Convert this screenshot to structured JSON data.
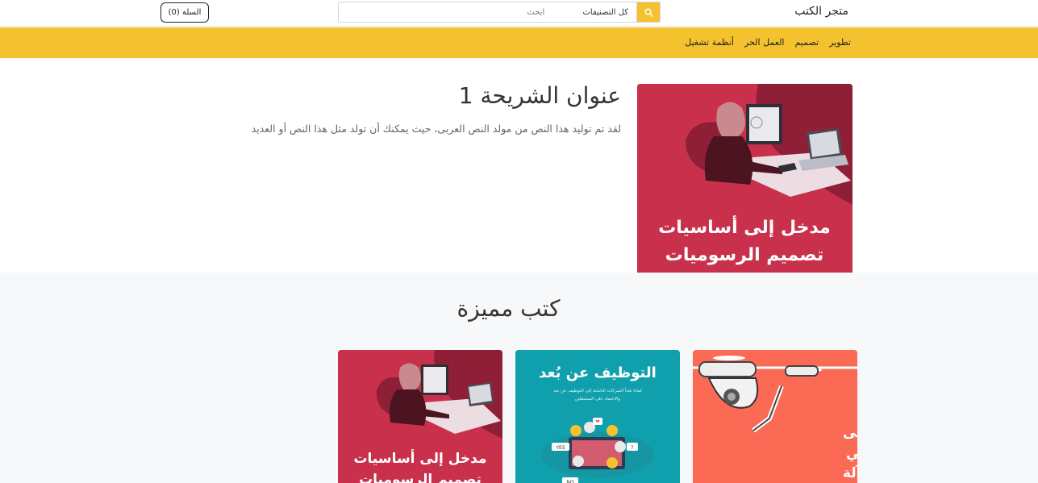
{
  "header": {
    "brand": "متجر الكتب",
    "search_placeholder": "ابحث",
    "category_select": "كل التصنيفات",
    "cart_label": "السلة (0)"
  },
  "categories": [
    "تطوير",
    "تصميم",
    "العمل الحر",
    "أنظمة تشغيل"
  ],
  "hero": {
    "title": "عنوان الشريحة 1",
    "text": "لقد تم توليد هذا النص من مولد النص العربى، حيث يمكنك أن تولد مثل هذا النص أو العديد",
    "cover_line1": "مدخل إلى أساسيات",
    "cover_line2": "تصميم الرسوميات"
  },
  "featured": {
    "title": "كتب مميزة",
    "books": [
      {
        "line1": "مدخل إلى",
        "line2": "الذكاء الاصطناعي",
        "line3": "وتعلّم الآلة"
      },
      {
        "title": "التوظيف عن بُعد",
        "subtitle1": "لماذا تلجأ الشركات الناشئة إلى التوظيف عن بعد",
        "subtitle2": "والاعتماد على المستقلين",
        "tag_yes": "YES",
        "tag_no": "NO",
        "tag_q": "?"
      },
      {
        "line1": "مدخل إلى أساسيات",
        "line2": "تصميم الرسوميات"
      }
    ]
  },
  "colors": {
    "accent": "#f4c22e",
    "hero_cover": "#c9304b",
    "ai_cover": "#fa6a55",
    "remote_cover": "#10a0ad"
  },
  "icons": {
    "search": "search-icon"
  }
}
